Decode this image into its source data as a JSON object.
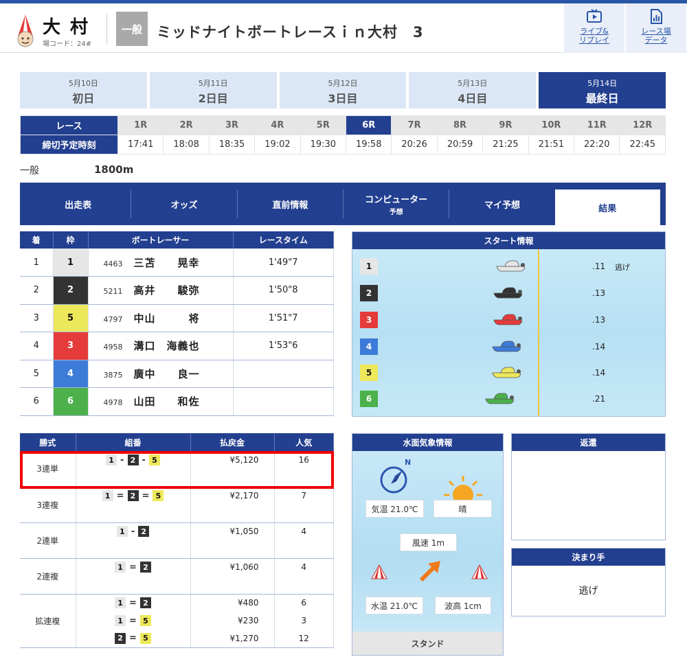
{
  "header": {
    "venue": "大村",
    "venue_code": "場コード：24#",
    "grade": "一般",
    "race_title": "ミッドナイトボートレースｉｎ大村　3",
    "links": [
      {
        "line1": "ライブ&",
        "line2": "リプレイ"
      },
      {
        "line1": "レース場",
        "line2": "データ"
      }
    ]
  },
  "days": [
    {
      "date": "5月10日",
      "name": "初日"
    },
    {
      "date": "5月11日",
      "name": "2日目"
    },
    {
      "date": "5月12日",
      "name": "3日目"
    },
    {
      "date": "5月13日",
      "name": "4日目"
    },
    {
      "date": "5月14日",
      "name": "最終日"
    }
  ],
  "race_grid": {
    "race_label": "レース",
    "time_label": "締切予定時刻",
    "races": [
      "1R",
      "2R",
      "3R",
      "4R",
      "5R",
      "6R",
      "7R",
      "8R",
      "9R",
      "10R",
      "11R",
      "12R"
    ],
    "times": [
      "17:41",
      "18:08",
      "18:35",
      "19:02",
      "19:30",
      "19:58",
      "20:26",
      "20:59",
      "21:25",
      "21:51",
      "22:20",
      "22:45"
    ],
    "active_index": 5
  },
  "race_info": {
    "class": "一般",
    "distance": "1800m"
  },
  "tabs": [
    {
      "label": "出走表",
      "sub": ""
    },
    {
      "label": "オッズ",
      "sub": ""
    },
    {
      "label": "直前情報",
      "sub": ""
    },
    {
      "label": "コンピューター",
      "sub": "予想"
    },
    {
      "label": "マイ予想",
      "sub": ""
    },
    {
      "label": "結果",
      "sub": ""
    }
  ],
  "results": {
    "headers": [
      "着",
      "枠",
      "ボートレーサー",
      "レースタイム"
    ],
    "rows": [
      {
        "place": "1",
        "waku": "1",
        "reg": "4463",
        "name": "三苫　　晃幸",
        "time": "1'49\"7"
      },
      {
        "place": "2",
        "waku": "2",
        "reg": "5211",
        "name": "高井　　駿弥",
        "time": "1'50\"8"
      },
      {
        "place": "3",
        "waku": "5",
        "reg": "4797",
        "name": "中山　　　将",
        "time": "1'51\"7"
      },
      {
        "place": "4",
        "waku": "3",
        "reg": "4958",
        "name": "溝口　海義也",
        "time": "1'53\"6"
      },
      {
        "place": "5",
        "waku": "4",
        "reg": "3875",
        "name": "廣中　　良一",
        "time": ""
      },
      {
        "place": "6",
        "waku": "6",
        "reg": "4978",
        "name": "山田　　和佐",
        "time": ""
      }
    ]
  },
  "start_info": {
    "title": "スタート情報",
    "lanes": [
      {
        "lane": "1",
        "st": ".11",
        "kimarite": "逃げ",
        "color": "#e6e6e6"
      },
      {
        "lane": "2",
        "st": ".13",
        "kimarite": "",
        "color": "#333333"
      },
      {
        "lane": "3",
        "st": ".13",
        "kimarite": "",
        "color": "#e53b3b"
      },
      {
        "lane": "4",
        "st": ".14",
        "kimarite": "",
        "color": "#3d7bd8"
      },
      {
        "lane": "5",
        "st": ".14",
        "kimarite": "",
        "color": "#ede85a"
      },
      {
        "lane": "6",
        "st": ".21",
        "kimarite": "",
        "color": "#4cb14a"
      }
    ]
  },
  "payout": {
    "headers": [
      "勝式",
      "組番",
      "払戻金",
      "人気"
    ],
    "groups": [
      {
        "kind": "3連単",
        "rows": [
          {
            "combo": [
              "1",
              "-",
              "2",
              "-",
              "5"
            ],
            "amount": "¥5,120",
            "pop": "16"
          }
        ]
      },
      {
        "kind": "3連複",
        "rows": [
          {
            "combo": [
              "1",
              "=",
              "2",
              "=",
              "5"
            ],
            "amount": "¥2,170",
            "pop": "7"
          }
        ]
      },
      {
        "kind": "2連単",
        "rows": [
          {
            "combo": [
              "1",
              "-",
              "2"
            ],
            "amount": "¥1,050",
            "pop": "4"
          }
        ]
      },
      {
        "kind": "2連複",
        "rows": [
          {
            "combo": [
              "1",
              "=",
              "2"
            ],
            "amount": "¥1,060",
            "pop": "4"
          }
        ]
      },
      {
        "kind": "拡連複",
        "rows": [
          {
            "combo": [
              "1",
              "=",
              "2"
            ],
            "amount": "¥480",
            "pop": "6"
          },
          {
            "combo": [
              "1",
              "=",
              "5"
            ],
            "amount": "¥230",
            "pop": "3"
          },
          {
            "combo": [
              "2",
              "=",
              "5"
            ],
            "amount": "¥1,270",
            "pop": "12"
          }
        ]
      }
    ]
  },
  "weather": {
    "title": "水面気象情報",
    "north": "N",
    "temp": "気温 21.0℃",
    "condition": "晴",
    "wind": "風速 1m",
    "water_temp": "水温 21.0℃",
    "wave": "波高 1cm",
    "stand": "スタンド"
  },
  "refund": {
    "title": "返還"
  },
  "kimarite": {
    "title": "決まり手",
    "value": "逃げ"
  },
  "colors": {
    "navy": "#233f8f",
    "accent": "#2955a6",
    "highlight": "#ee0000"
  }
}
